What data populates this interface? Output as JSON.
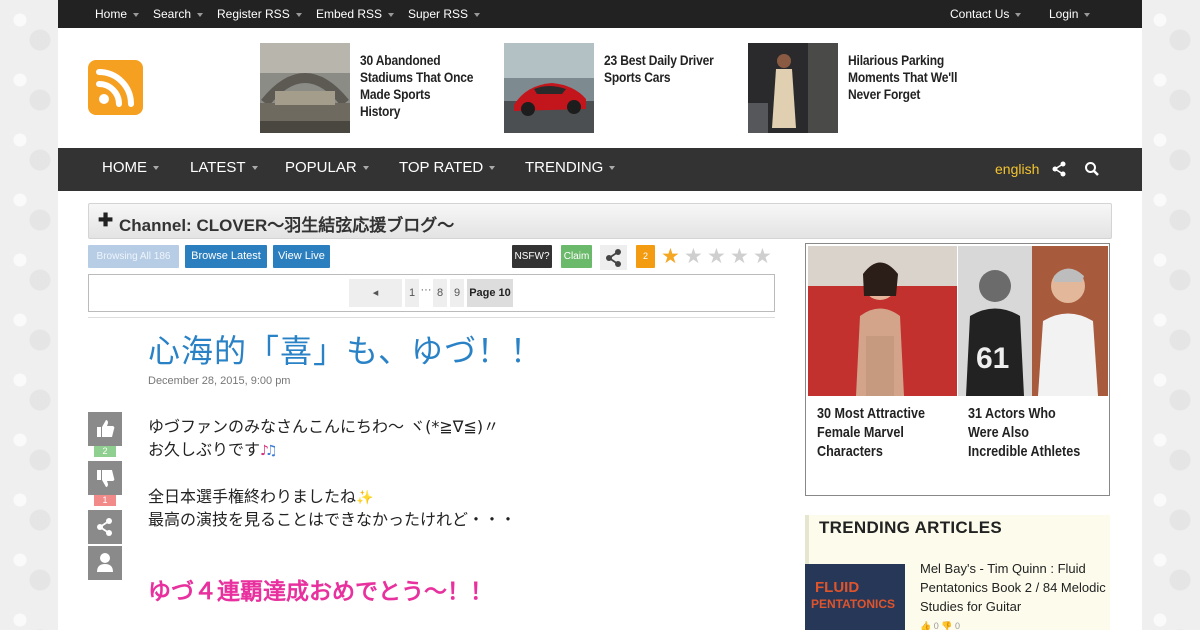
{
  "topnav": {
    "left": [
      "Home",
      "Search",
      "Register RSS",
      "Embed RSS",
      "Super RSS"
    ],
    "right": [
      "Contact Us",
      "Login"
    ]
  },
  "promos": [
    {
      "title": "30 Abandoned Stadiums That Once Made Sports History"
    },
    {
      "title": "23 Best Daily Driver Sports Cars"
    },
    {
      "title": "Hilarious Parking Moments That We'll Never Forget"
    }
  ],
  "mainnav": {
    "items": [
      "HOME",
      "LATEST",
      "POPULAR",
      "TOP RATED",
      "TRENDING"
    ],
    "language": "english"
  },
  "channel": {
    "title": "Channel: CLOVER～羽生結弦応援ブログ～"
  },
  "toolbar": {
    "browsing_all": "Browsing All 186",
    "browse_latest": "Browse Latest",
    "view_live": "View Live",
    "nsfw": "NSFW?",
    "claim": "Claim",
    "rating_count": "2",
    "rating_stars": 1,
    "rating_max": 5
  },
  "pager": {
    "pages": [
      "1",
      "8",
      "9"
    ],
    "current": "Page 10"
  },
  "post": {
    "title": "心海的「喜」も、ゆづ！！",
    "date": "December 28, 2015, 9:00 pm",
    "lines": [
      "ゆづファンのみなさんこんにちわ～ ヾ(*≧∇≦)〃",
      "お久しぶりです",
      "全日本選手権終わりましたね",
      "最高の演技を見ることはできなかったけれど・・・"
    ],
    "highlight": "ゆづ４連覇達成おめでとう～！！",
    "likes": "2",
    "dislikes": "1"
  },
  "sidebar": {
    "ads": [
      {
        "title": "30 Most Attractive Female Marvel Characters"
      },
      {
        "title": "31 Actors Who Were Also Incredible Athletes"
      }
    ],
    "trending": {
      "heading": "TRENDING ARTICLES",
      "article_title": "Mel Bay's - Tim Quinn : Fluid Pentatonics Book 2 / 84 Melodic Studies for Guitar",
      "likes": "0",
      "dislikes": "0"
    }
  }
}
